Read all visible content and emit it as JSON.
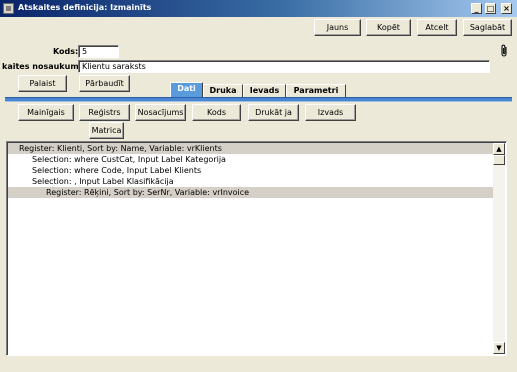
{
  "window": {
    "title": "Atskaites definīcija: Izmainīts",
    "controls": [
      "_",
      "□",
      "×"
    ]
  },
  "toolbar": {
    "jauns": "Jauns",
    "kopet": "Kopēt",
    "atcelt": "Atcelt",
    "saglabat": "Saglabāt"
  },
  "form": {
    "kods_label": "Kods:",
    "kods_value": "5",
    "nosaukums_label": "kaites nosaukums:",
    "nosaukums_value": "Klientu saraksts"
  },
  "actions": {
    "palaist": "Palaist",
    "parbaudit": "Pārbaudīt"
  },
  "tabs": [
    "Dati",
    "Druka",
    "Ievads",
    "Parametri"
  ],
  "data_buttons": [
    "Mainīgais",
    "Reģistrs",
    "Nosacījums",
    "Kods",
    "Drukāt ja",
    "Izvads",
    "Matrica"
  ],
  "list": {
    "rows": [
      "Register: Klienti, Sort by: Name, Variable: vrKlients",
      "Selection: where CustCat, Input Label Kategorija",
      "Selection: where Code, Input Label Klients",
      "Selection: , Input Label Klasifikācija",
      "Register: Rēķini, Sort by: SerNr, Variable: vrInvoice"
    ]
  },
  "icons": {
    "window_icon": "window-icon",
    "attachment": "paperclip-icon",
    "scroll_up": "▲",
    "scroll_down": "▼"
  }
}
